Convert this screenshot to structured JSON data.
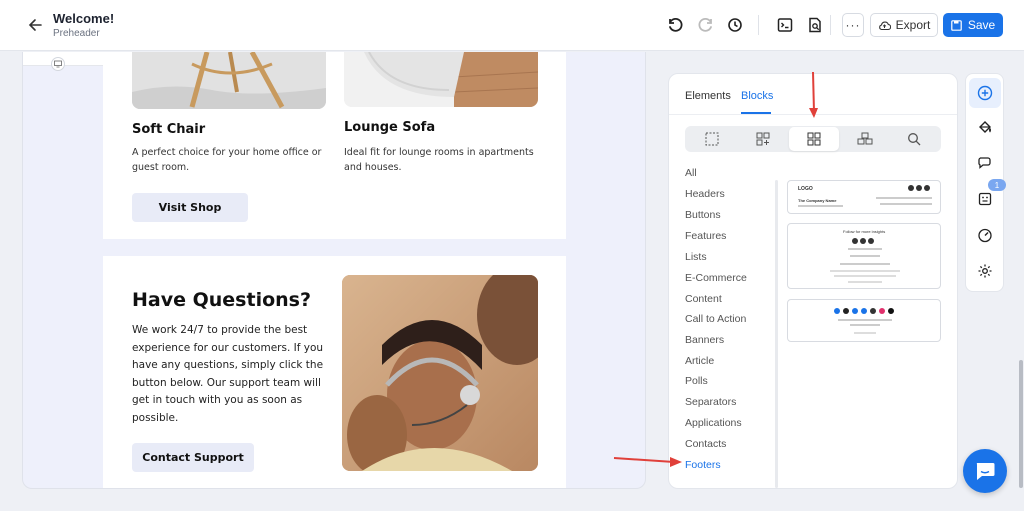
{
  "header": {
    "title": "Welcome!",
    "subtitle": "Preheader",
    "export_label": "Export",
    "save_label": "Save",
    "more_label": "···"
  },
  "email": {
    "products": [
      {
        "title": "Soft Chair",
        "description": "A perfect choice for your home office or guest room."
      },
      {
        "title": "Lounge Sofa",
        "description": "Ideal fit for lounge rooms in apartments and houses."
      }
    ],
    "visit_button": "Visit Shop",
    "questions_title": "Have Questions?",
    "questions_text": "We work 24/7 to provide the best experience for our customers. If you have any questions, simply click the button below. Our support team will get in touch with you as soon as possible.",
    "contact_button": "Contact Support"
  },
  "panel": {
    "tabs": [
      "Elements",
      "Blocks"
    ],
    "active_tab": "Blocks",
    "categories": [
      "All",
      "Headers",
      "Buttons",
      "Features",
      "Lists",
      "E-Commerce",
      "Content",
      "Call to Action",
      "Banners",
      "Article",
      "Polls",
      "Separators",
      "Applications",
      "Contacts",
      "Footers"
    ],
    "active_category": "Footers",
    "thumb1": {
      "logo": "LOGO",
      "company": "The Company Name"
    },
    "thumb2": {
      "heading": "Follow for more insights"
    }
  },
  "rail": {
    "badge": "1"
  },
  "colors": {
    "accent": "#1a73e8",
    "annotation_arrow": "#e0403a"
  }
}
